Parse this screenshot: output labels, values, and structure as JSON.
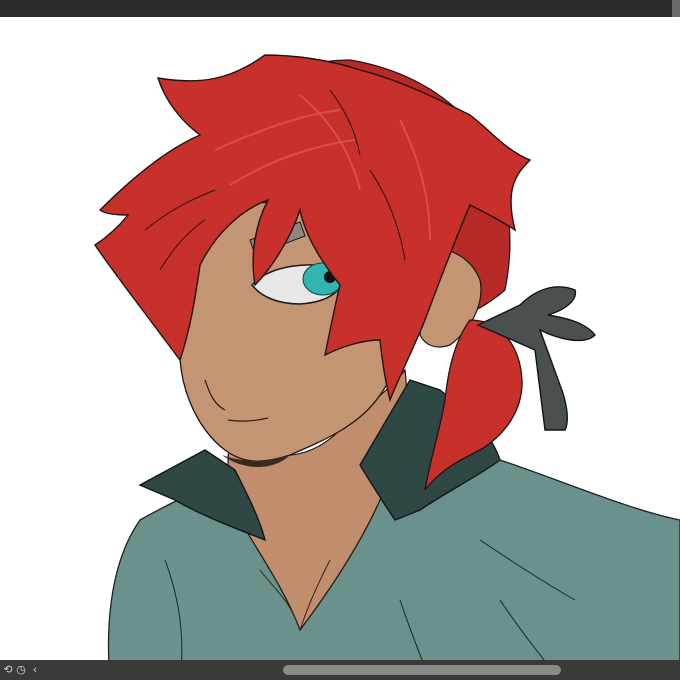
{
  "app": {
    "window_bar": {},
    "canvas": {
      "artwork": "illustration-red-haired-character"
    },
    "status_bar": {
      "icons": [
        "rotate-icon",
        "timer-icon",
        "chevron-left-icon"
      ],
      "horizontal_scroll": {
        "thumb_start_fraction": 0.38,
        "thumb_size_fraction": 0.44
      }
    }
  },
  "colors": {
    "window_bar": "#2b2b2b",
    "status_bar": "#3a3a3a",
    "canvas_bg": "#ffffff",
    "hair": "#c7302b",
    "skin": "#c49573",
    "shirt": "#6a918c",
    "eye": "#32b5b0",
    "ribbon": "#4a5050"
  }
}
